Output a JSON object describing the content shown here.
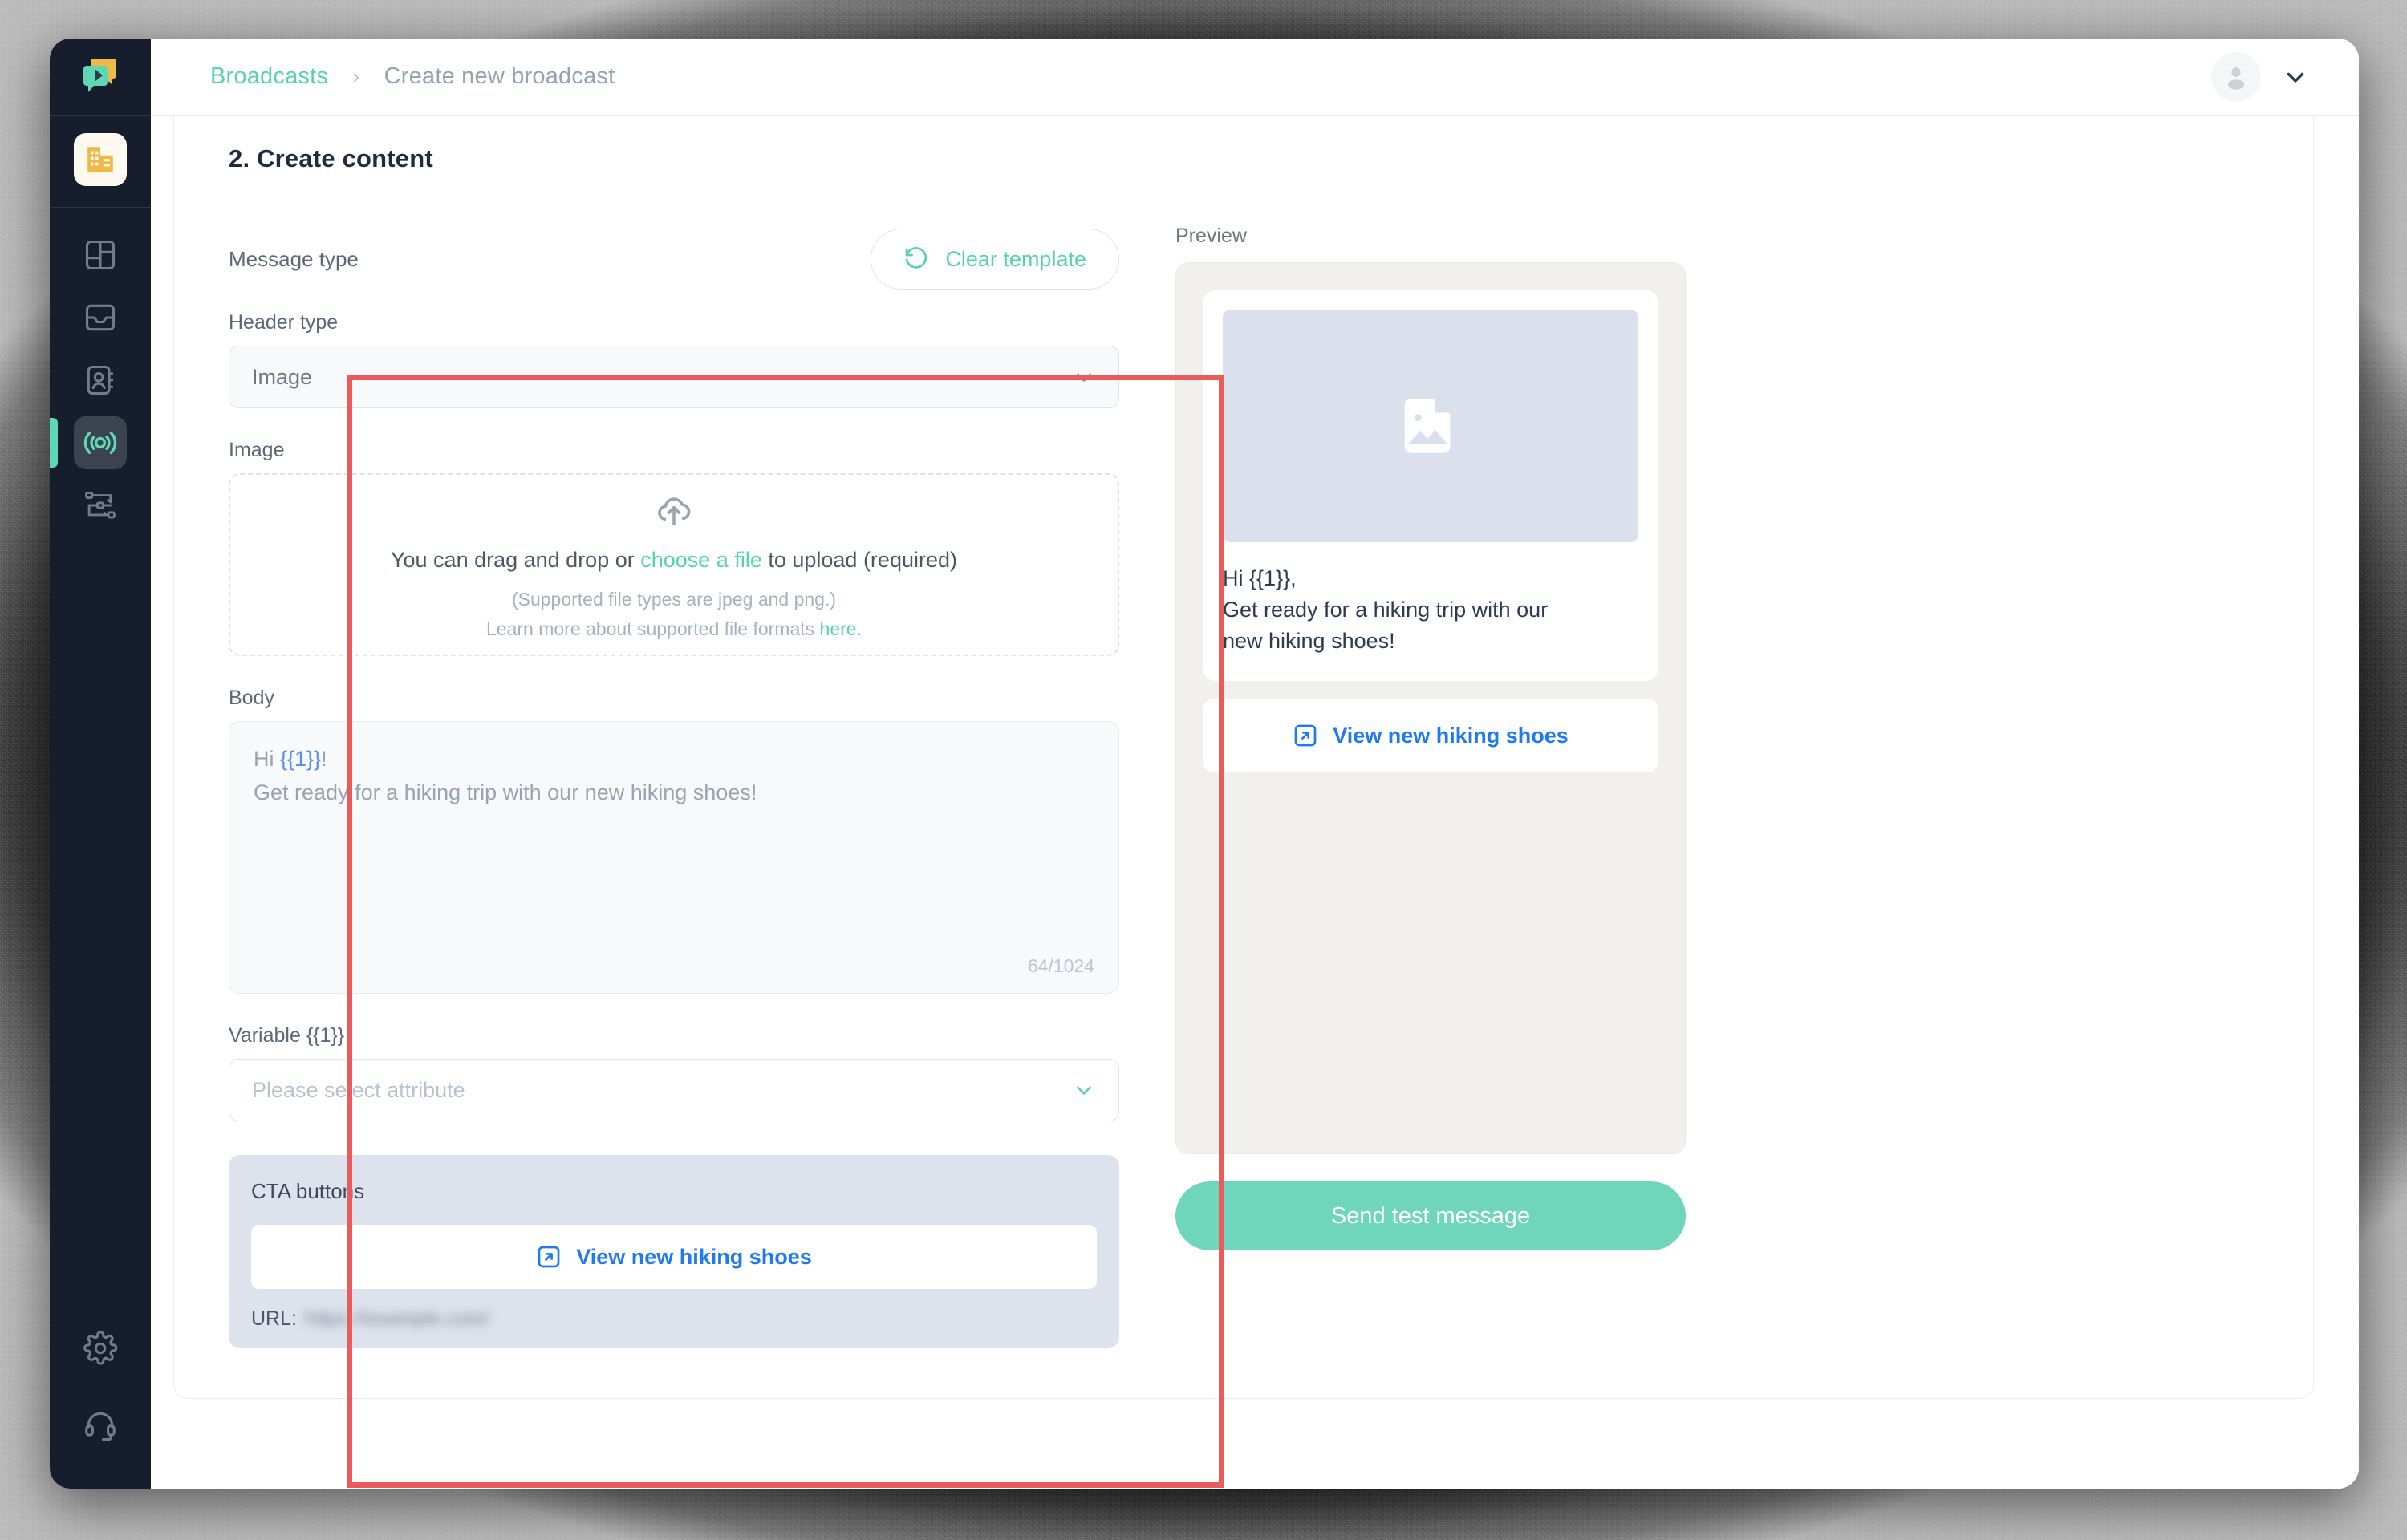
{
  "sidebar": {
    "logo_icon": "chat-bubbles-logo",
    "items": [
      {
        "icon": "building-icon",
        "name": "workspace",
        "active": false
      },
      {
        "icon": "dashboard-icon",
        "name": "dashboard",
        "active": false
      },
      {
        "icon": "inbox-icon",
        "name": "inbox",
        "active": false
      },
      {
        "icon": "contacts-icon",
        "name": "contacts",
        "active": false
      },
      {
        "icon": "broadcast-icon",
        "name": "broadcasts",
        "active": true
      },
      {
        "icon": "automation-icon",
        "name": "automations",
        "active": false
      }
    ],
    "bottom_items": [
      {
        "icon": "gear-icon",
        "name": "settings"
      },
      {
        "icon": "headset-icon",
        "name": "support"
      }
    ]
  },
  "topbar": {
    "breadcrumb_root": "Broadcasts",
    "breadcrumb_separator": "›",
    "breadcrumb_current": "Create new broadcast",
    "avatar_icon": "user-avatar-icon",
    "chevron_icon": "chevron-down-icon"
  },
  "step": {
    "title": "2. Create content"
  },
  "form": {
    "message_type_label": "Message type",
    "clear_template_label": "Clear template",
    "clear_template_icon": "reset-icon",
    "header_type_label": "Header type",
    "header_type_value": "Image",
    "image_label": "Image",
    "dropzone": {
      "upload_icon": "cloud-upload-icon",
      "text_before": "You can drag and drop or ",
      "link": "choose a file",
      "text_after": " to upload (required)",
      "supported": "(Supported file types are jpeg and png.)",
      "learn_more_before": "Learn more about supported file formats ",
      "learn_more_link": "here",
      "learn_more_after": "."
    },
    "body_label": "Body",
    "body_line1_before": "Hi ",
    "body_line1_token": "{{1}}",
    "body_line1_after": "!",
    "body_line2": "Get ready for a hiking trip with our new hiking shoes!",
    "body_counter": "64/1024",
    "variable_label": "Variable {{1}}",
    "variable_placeholder": "Please select attribute",
    "cta_section_title": "CTA buttons",
    "cta_button_label": "View new hiking shoes",
    "cta_button_icon": "external-link-icon",
    "cta_url_label": "URL:",
    "cta_url_value": "https://example.com/"
  },
  "preview": {
    "label": "Preview",
    "image_placeholder_icon": "image-placeholder-icon",
    "message_line1": "Hi {{1}},",
    "message_line2": "Get ready for a hiking trip with our",
    "message_line3": "new hiking shoes!",
    "cta_label": "View new hiking shoes",
    "cta_icon": "external-link-icon",
    "send_test_label": "Send test message"
  },
  "annotation": {
    "color": "#ea5b5b"
  },
  "colors": {
    "accent_green": "#56d3ad",
    "link_blue": "#1f79f3",
    "sidebar_dark": "#161d2c",
    "annotation_red": "#ea5b5b",
    "cta_panel": "#dde3ec"
  }
}
